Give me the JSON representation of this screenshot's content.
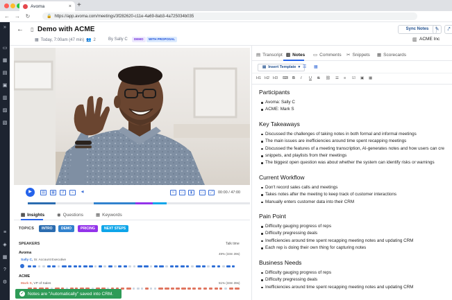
{
  "browser": {
    "tab_title": "Avoma",
    "url": "https://app.avoma.com/meetings/3f282620-c11e-4a69-8ab3-4a725034b035"
  },
  "header": {
    "title": "Demo with ACME",
    "date": "Today, 7:00am (47 min)",
    "attendees": "2",
    "organizer": "By Sally C",
    "badges": [
      "DEMO",
      "WITH PROPOSAL"
    ],
    "sync_label": "Sync Notes",
    "company": "ACME Inc"
  },
  "player": {
    "time": "00:00 / 47:00"
  },
  "insights": {
    "tabs": [
      "Insights",
      "Questions",
      "Keywords"
    ],
    "topics_label": "TOPICS",
    "topics": [
      "INTRO",
      "DEMO",
      "PRICING",
      "NEXT STEPS"
    ],
    "speakers_label": "SPEAKERS",
    "talk_time_label": "Talk time",
    "groups": [
      {
        "org": "Avoma",
        "speaker_name": "Sally C,",
        "speaker_role": "Sr. Account Executive",
        "pct": "49% (33m 39s)"
      },
      {
        "org": "ACME",
        "speaker_name": "Mark S,",
        "speaker_role": "VP of Sales",
        "pct": "51% (33m 39s)"
      }
    ]
  },
  "toast": "Notes are \"Automatically\" saved into CRM.",
  "right": {
    "tabs": [
      "Transcript",
      "Notes",
      "Comments",
      "Snippets",
      "Scorecards"
    ],
    "insert_template": "Insert Template",
    "format_buttons": [
      "H1",
      "H2",
      "H3",
      "B",
      "I",
      "U",
      "S"
    ]
  },
  "notes": {
    "sections": [
      {
        "heading": "Participants",
        "items": [
          "Avoma: Sally C",
          "ACME: Mark S"
        ]
      },
      {
        "heading": "Key Takeaways",
        "items": [
          "Discussed the challenges of taking notes in both formal and informal meetings",
          "The main issues are inefficiencies around time spent recapping meetings",
          "Discussed the features of a meeting transcription, AI-generates notes and how users can cre",
          "snippets, and playlists from their meetings",
          "The biggest open question was about whether the system can identify risks or warnings"
        ]
      },
      {
        "heading": "Current Workflow",
        "items": [
          "Don't record sales calls and meetings",
          "Takes notes after the meeting to keep track of customer interactions",
          "Manually enters customer data into their CRM"
        ]
      },
      {
        "heading": "Pain Point",
        "items": [
          "Difficulty gauging progress of reps",
          "Difficulty pregressing deals",
          "Inefficiencies around time spent recapping meeting notes and updating CRM",
          "Each rep is doing their own thing for capturing notes"
        ]
      },
      {
        "heading": "Business Needs",
        "items": [
          "Difficulty gauging progress of reps",
          "Difficulty pregressing deals",
          "Inefficiencies around time spent recapping meeting notes and updating CRM"
        ]
      }
    ]
  },
  "colors": {
    "accent": "#2563eb",
    "topic_intro": "#2b6cb0",
    "topic_demo": "#3182ce",
    "topic_pricing": "#9333ea",
    "topic_next": "#0ea5e9",
    "speaker_a": "#2f6fd6",
    "speaker_b": "#e07560",
    "toast": "#2e9b57"
  }
}
